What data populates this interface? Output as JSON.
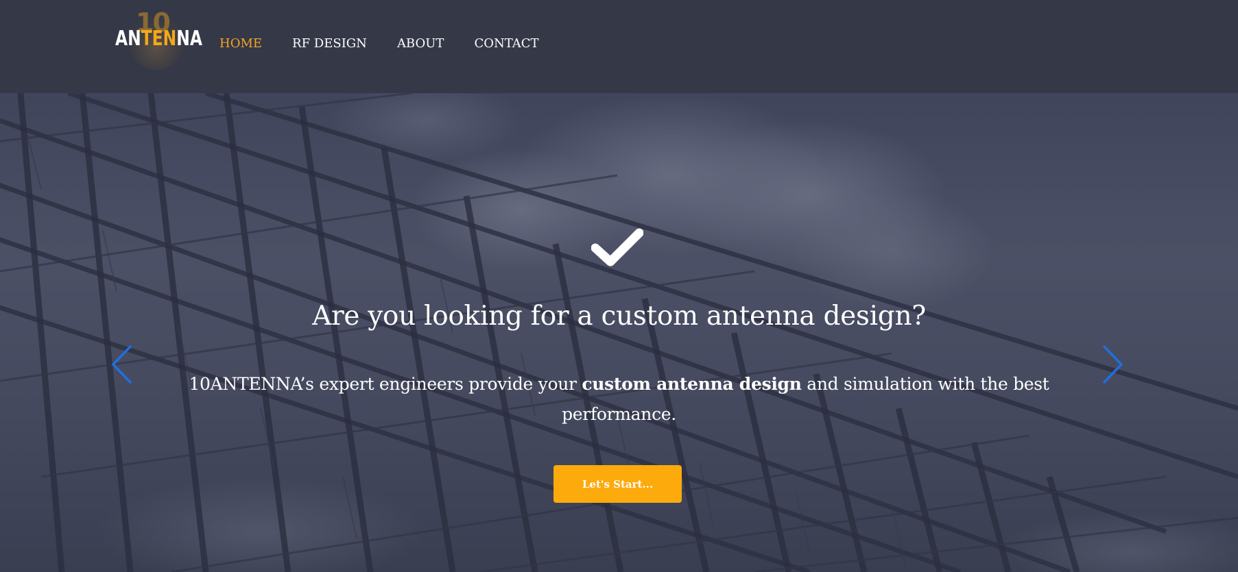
{
  "logo": {
    "number": "10",
    "word_part1": "AN",
    "word_part2": "TEN",
    "word_part3": "NA",
    "accent_color": "#f4a81a"
  },
  "nav": {
    "items": [
      {
        "label": "HOME",
        "active": true
      },
      {
        "label": "RF DESIGN",
        "active": false
      },
      {
        "label": "ABOUT",
        "active": false
      },
      {
        "label": "CONTACT",
        "active": false
      }
    ],
    "active_color": "#f5a623",
    "text_color": "#ffffff",
    "background": "#353847"
  },
  "hero": {
    "icon": "check-icon",
    "headline": "Are you looking for a custom antenna design?",
    "sub_before": "10ANTENNA’s expert engineers provide your ",
    "sub_bold": "custom antenna design",
    "sub_after": " and simulation with the best performance.",
    "cta_label": "Let's Start...",
    "cta_color": "#fdaa0c",
    "prev_icon": "chevron-left-icon",
    "next_icon": "chevron-right-icon",
    "arrow_color": "#1f6fe0"
  }
}
